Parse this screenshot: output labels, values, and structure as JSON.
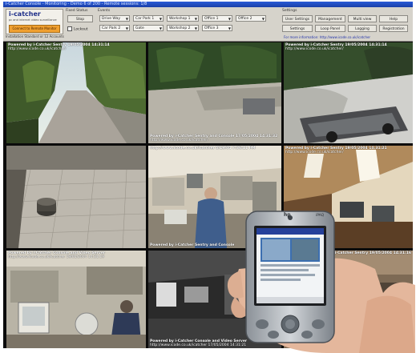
{
  "window": {
    "title": "i-Catcher Console - Monitoring - Demo 6 of 200 - Remote sessions: 1/8"
  },
  "toolbar": {
    "logo": "i-catcher",
    "logo_sub": "pc and internet video surveillance",
    "orange_button": "Connect to Remote Monitor",
    "status_line": "Installation Standard or 12 Accounts",
    "fixed_status_label": "Fixed Status",
    "stop_button": "Stop",
    "lockout_label": "Lockout",
    "events_label": "Events",
    "cameras": [
      "Drive Way",
      "Car Park 1",
      "Workshop 1",
      "Office 1",
      "Office 2",
      "Car Park 2",
      "Gate",
      "Workshop 2",
      "Office 3"
    ],
    "settings_label": "Settings",
    "settings_buttons": [
      "User Settings",
      "Management",
      "Multi view",
      "Help",
      "Settings",
      "Loop Panel",
      "Logging",
      "Registration"
    ],
    "footer_link": "For more information: http://www.icode.co.uk/icatcher"
  },
  "cameras": [
    {
      "caption": "Powered by i-Catcher Sentry 19/05/2004 14:31:14",
      "url": "http://www.icode.co.uk/icatcher/"
    },
    {
      "caption": "Powered by i-Catcher Sentry and Console 17/05/2004 14:31:32",
      "url": "http://www.icode.co.uk/icatcher/"
    },
    {
      "caption": "Powered by i-Catcher Sentry 19/05/2004 14:31:14",
      "url": "http://www.icode.co.uk/icatcher/"
    },
    {
      "caption": "Powered by i-Catcher Sentry and Console",
      "url": "http://www.icode.co.uk/icatcher 5/19/04 7:36:11 PM"
    },
    {
      "caption": "Powered by i-Catcher Sentry 19/05/2004 14:31:21",
      "url": "http://www.icode.co.uk/icatcher/"
    },
    {
      "caption": "Powered by i-Catcher Console and Video Server",
      "url": "http://www.icode.co.uk/icatcher 19/05/2004 14:31:19"
    },
    {
      "caption": "Powered by i-Catcher Console and Video Server",
      "url": "http://www.icode.co.uk/icatcher 17/05/2004 14:31:21"
    },
    {
      "caption": "Powered by i-Catcher Sentry 19/05/2004 14:31:16",
      "url": ""
    }
  ],
  "pda": {
    "brand": "hp",
    "model": "iPAQ"
  }
}
